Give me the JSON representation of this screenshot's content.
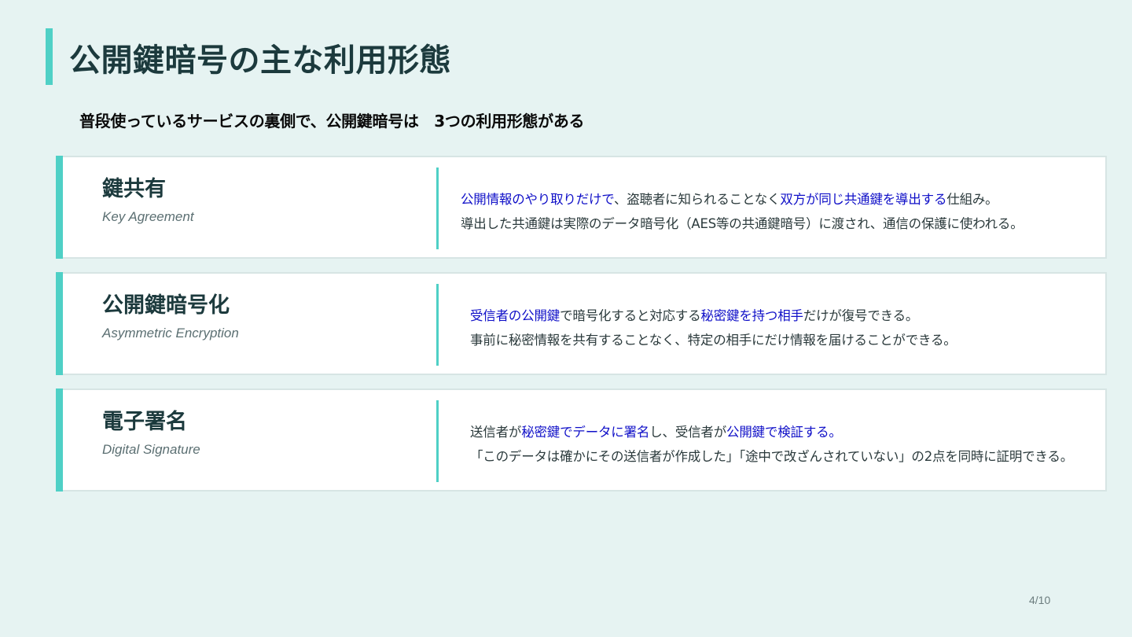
{
  "slide": {
    "title": "公開鍵暗号の主な利用形態",
    "subtitle": "普段使っているサービスの裏側で、公開鍵暗号は　3つの利用形態がある",
    "page": "4/10"
  },
  "colors": {
    "accent": "#4fd0c6",
    "highlight": "#1010c8",
    "title": "#1c3a3d",
    "background": "#e6f3f2"
  },
  "cards": [
    {
      "name": "鍵共有",
      "english": "Key Agreement",
      "line1": [
        {
          "text": "公開情報のやり取りだけで",
          "hl": true
        },
        {
          "text": "、盗聴者に知られることなく",
          "hl": false
        },
        {
          "text": "双方が同じ共通鍵を導出する",
          "hl": true
        },
        {
          "text": "仕組み。",
          "hl": false
        }
      ],
      "line2": "導出した共通鍵は実際のデータ暗号化（AES等の共通鍵暗号）に渡され、通信の保護に使われる。"
    },
    {
      "name": "公開鍵暗号化",
      "english": "Asymmetric Encryption",
      "line1": [
        {
          "text": "受信者の公開鍵",
          "hl": true
        },
        {
          "text": "で暗号化すると対応する",
          "hl": false
        },
        {
          "text": "秘密鍵を持つ相手",
          "hl": true
        },
        {
          "text": "だけが復号できる。",
          "hl": false
        }
      ],
      "line2": "事前に秘密情報を共有することなく、特定の相手にだけ情報を届けることができる。"
    },
    {
      "name": "電子署名",
      "english": "Digital Signature",
      "line1": [
        {
          "text": "送信者が",
          "hl": false
        },
        {
          "text": "秘密鍵でデータに署名",
          "hl": true
        },
        {
          "text": "し、受信者が",
          "hl": false
        },
        {
          "text": "公開鍵で検証する。",
          "hl": true
        }
      ],
      "line2": "「このデータは確かにその送信者が作成した」「途中で改ざんされていない」の2点を同時に証明できる。"
    }
  ]
}
